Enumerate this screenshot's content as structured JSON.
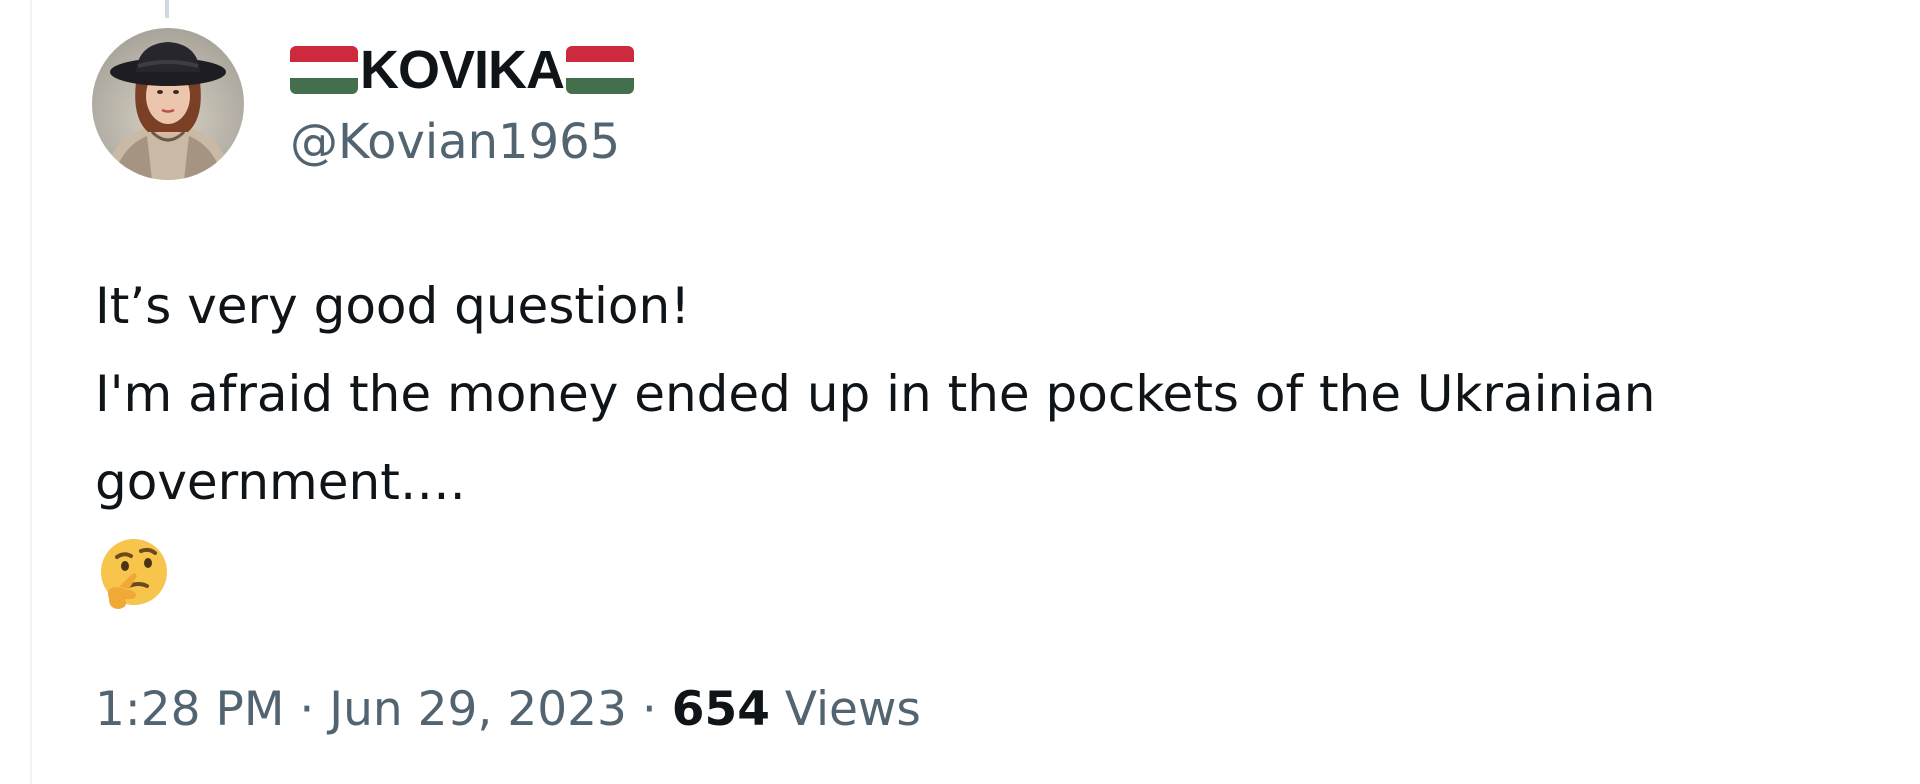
{
  "tweet": {
    "author": {
      "display_name": "KOVIKA",
      "handle": "@Kovian1965",
      "flag_icon": "hungary-flag-icon"
    },
    "text_lines": [
      "It’s very good question!",
      "I'm afraid the money ended up in the pockets of the Ukrainian",
      "government…."
    ],
    "emoji_icon": "thinking-face-emoji-icon",
    "time": "1:28 PM",
    "separator": "·",
    "date": "Jun 29, 2023",
    "views_count": "654",
    "views_label": "Views"
  },
  "colors": {
    "text_primary": "#0f1419",
    "text_secondary": "#536471",
    "border": "#eff3f4",
    "flag_red": "#cd2a3e",
    "flag_white": "#ffffff",
    "flag_green": "#436f4d"
  }
}
